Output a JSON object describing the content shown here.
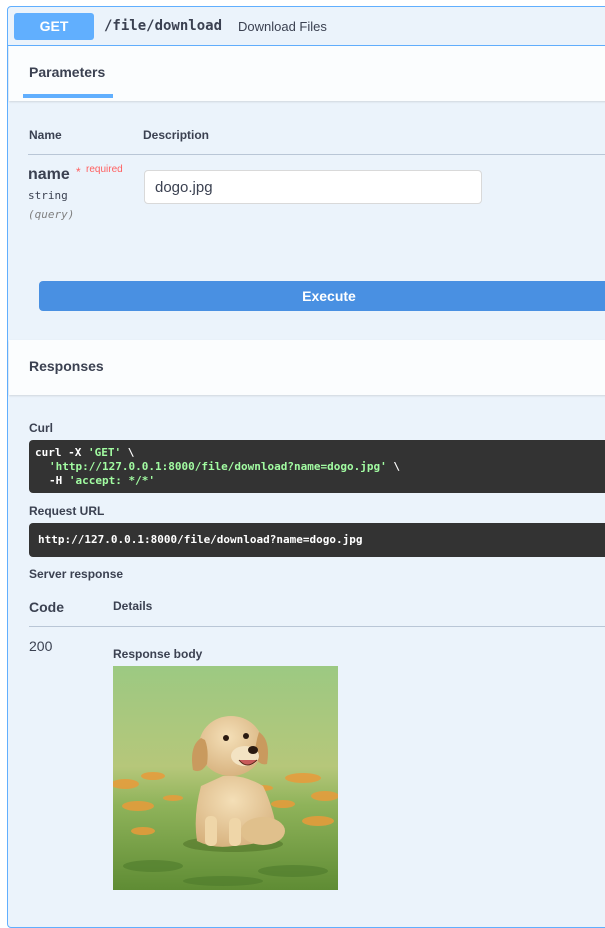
{
  "endpoint": {
    "method": "GET",
    "path": "/file/download",
    "description": "Download Files"
  },
  "parameters_tab": {
    "label": "Parameters"
  },
  "parameters_table": {
    "headers": [
      "Name",
      "Description"
    ],
    "rows": [
      {
        "name": "name",
        "required_star": "*",
        "required_text": "required",
        "type": "string",
        "in": "(query)",
        "value": "dogo.jpg"
      }
    ]
  },
  "execute_button": {
    "label": "Execute"
  },
  "responses": {
    "header": "Responses",
    "curl": {
      "label": "Curl",
      "line1_prefix": "curl -X ",
      "line1_method": "'GET'",
      "line1_suffix": " \\",
      "line2_url": "'http://127.0.0.1:8000/file/download?name=dogo.jpg'",
      "line2_suffix": " \\",
      "line3_prefix": "-H ",
      "line3_header": "'accept: */*'"
    },
    "request_url": {
      "label": "Request URL",
      "value": "http://127.0.0.1:8000/file/download?name=dogo.jpg"
    },
    "server_response": {
      "label": "Server response",
      "code_header": "Code",
      "details_header": "Details",
      "code": "200",
      "body_label": "Response body",
      "body_image": "puppy-photo"
    }
  },
  "colors": {
    "accent": "#61affe",
    "execute": "#4990e2",
    "required": "#ff6060",
    "code_bg": "#333333"
  }
}
